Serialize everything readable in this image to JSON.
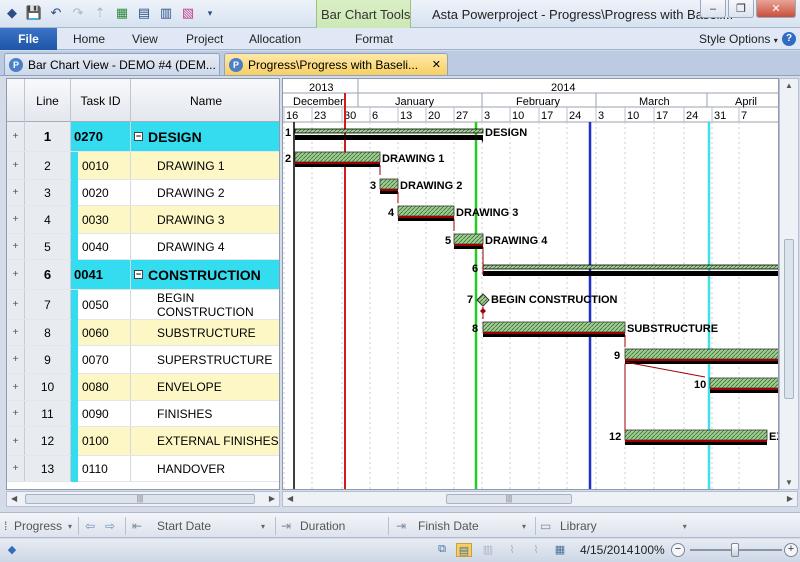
{
  "title_bar": {
    "context_tab": "Bar Chart Tools",
    "app_title": "Asta Powerproject - Progress\\Progress with Baseli...",
    "min_label": "–",
    "max_label": "❐",
    "close_label": "✕"
  },
  "ribbon": {
    "file": "File",
    "tabs": [
      "Home",
      "View",
      "Project",
      "Allocation",
      "Format"
    ],
    "style_options": "Style Options",
    "help": "?"
  },
  "doc_tabs": [
    {
      "label": "Bar Chart View - DEMO #4 (DEM..."
    },
    {
      "label": "Progress\\Progress with Baseli...",
      "close": "✕"
    }
  ],
  "grid": {
    "headers": {
      "line": "Line",
      "task_id": "Task ID",
      "name": "Name"
    },
    "rows": [
      {
        "exp": "+",
        "line": "1",
        "task_id": "0270",
        "name": "DESIGN",
        "summary": true,
        "collapse": "−"
      },
      {
        "exp": "+",
        "line": "2",
        "task_id": "0010",
        "name": "DRAWING 1"
      },
      {
        "exp": "+",
        "line": "3",
        "task_id": "0020",
        "name": "DRAWING 2"
      },
      {
        "exp": "+",
        "line": "4",
        "task_id": "0030",
        "name": "DRAWING 3"
      },
      {
        "exp": "+",
        "line": "5",
        "task_id": "0040",
        "name": "DRAWING 4"
      },
      {
        "exp": "+",
        "line": "6",
        "task_id": "0041",
        "name": "CONSTRUCTION",
        "summary": true,
        "collapse": "−"
      },
      {
        "exp": "+",
        "line": "7",
        "task_id": "0050",
        "name": "BEGIN CONSTRUCTION"
      },
      {
        "exp": "+",
        "line": "8",
        "task_id": "0060",
        "name": "SUBSTRUCTURE"
      },
      {
        "exp": "+",
        "line": "9",
        "task_id": "0070",
        "name": "SUPERSTRUCTURE"
      },
      {
        "exp": "+",
        "line": "10",
        "task_id": "0080",
        "name": "ENVELOPE"
      },
      {
        "exp": "+",
        "line": "11",
        "task_id": "0090",
        "name": "FINISHES"
      },
      {
        "exp": "+",
        "line": "12",
        "task_id": "0100",
        "name": "EXTERNAL FINISHES"
      },
      {
        "exp": "+",
        "line": "13",
        "task_id": "0110",
        "name": "HANDOVER"
      }
    ]
  },
  "gantt": {
    "years": [
      "2013",
      "2014"
    ],
    "months": [
      "December",
      "January",
      "February",
      "March",
      "April"
    ],
    "days": [
      "16",
      "23",
      "30",
      "6",
      "13",
      "20",
      "27",
      "3",
      "10",
      "17",
      "24",
      "3",
      "10",
      "17",
      "24",
      "31",
      "7"
    ],
    "bars": [
      {
        "num": "1",
        "label": "DESIGN",
        "kind": "summary"
      },
      {
        "num": "2",
        "label": "DRAWING 1",
        "kind": "task"
      },
      {
        "num": "3",
        "label": "DRAWING 2",
        "kind": "task"
      },
      {
        "num": "4",
        "label": "DRAWING 3",
        "kind": "task"
      },
      {
        "num": "5",
        "label": "DRAWING 4",
        "kind": "task"
      },
      {
        "num": "6",
        "label": "",
        "kind": "summary"
      },
      {
        "num": "7",
        "label": "BEGIN CONSTRUCTION",
        "kind": "milestone"
      },
      {
        "num": "8",
        "label": "SUBSTRUCTURE",
        "kind": "task"
      },
      {
        "num": "9",
        "label": "",
        "kind": "task"
      },
      {
        "num": "10",
        "label": "",
        "kind": "task"
      },
      {
        "num": "12",
        "label": "EX",
        "kind": "task"
      }
    ],
    "colors": {
      "red_line": "#d11b1b",
      "green_line": "#22cc22",
      "blue_line": "#1f2fc7",
      "cyan_line": "#3fe0e6",
      "bar_fill": "#9fd08f",
      "baseline": "#a00000"
    }
  },
  "toolbar": {
    "progress": "Progress",
    "start_date": "Start Date",
    "duration": "Duration",
    "finish_date": "Finish Date",
    "library": "Library"
  },
  "statusbar": {
    "date": "4/15/2014",
    "zoom": "100%",
    "zoom_minus": "−",
    "zoom_plus": "+"
  }
}
